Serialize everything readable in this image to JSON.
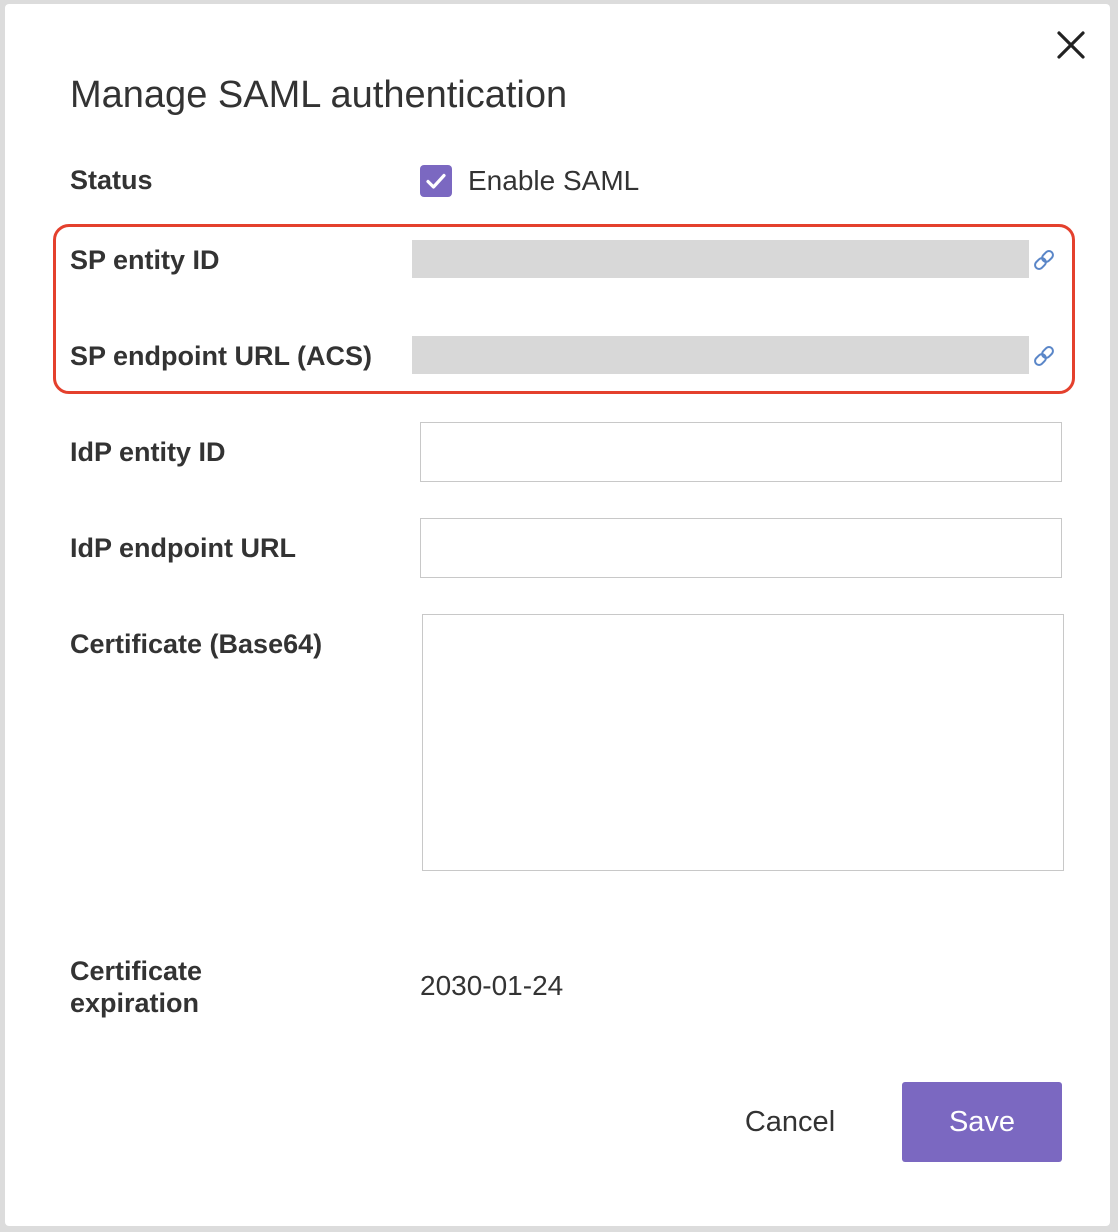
{
  "dialog": {
    "title": "Manage SAML authentication",
    "close_icon": "close-icon"
  },
  "status": {
    "label": "Status",
    "checkbox_label": "Enable SAML",
    "checked": true
  },
  "sp_entity_id": {
    "label": "SP entity ID",
    "value": "",
    "icon": "link-icon"
  },
  "sp_endpoint_url": {
    "label": "SP endpoint URL (ACS)",
    "value": "",
    "icon": "link-icon"
  },
  "idp_entity_id": {
    "label": "IdP entity ID",
    "value": ""
  },
  "idp_endpoint_url": {
    "label": "IdP endpoint URL",
    "value": ""
  },
  "certificate": {
    "label": "Certificate (Base64)",
    "value": ""
  },
  "certificate_expiration": {
    "label": "Certificate expiration",
    "value": "2030-01-24"
  },
  "buttons": {
    "cancel_label": "Cancel",
    "save_label": "Save"
  },
  "colors": {
    "accent": "#7b68c1",
    "highlight": "#e4402d",
    "redacted": "#d8d8d8",
    "link_icon": "#5a86c8"
  }
}
